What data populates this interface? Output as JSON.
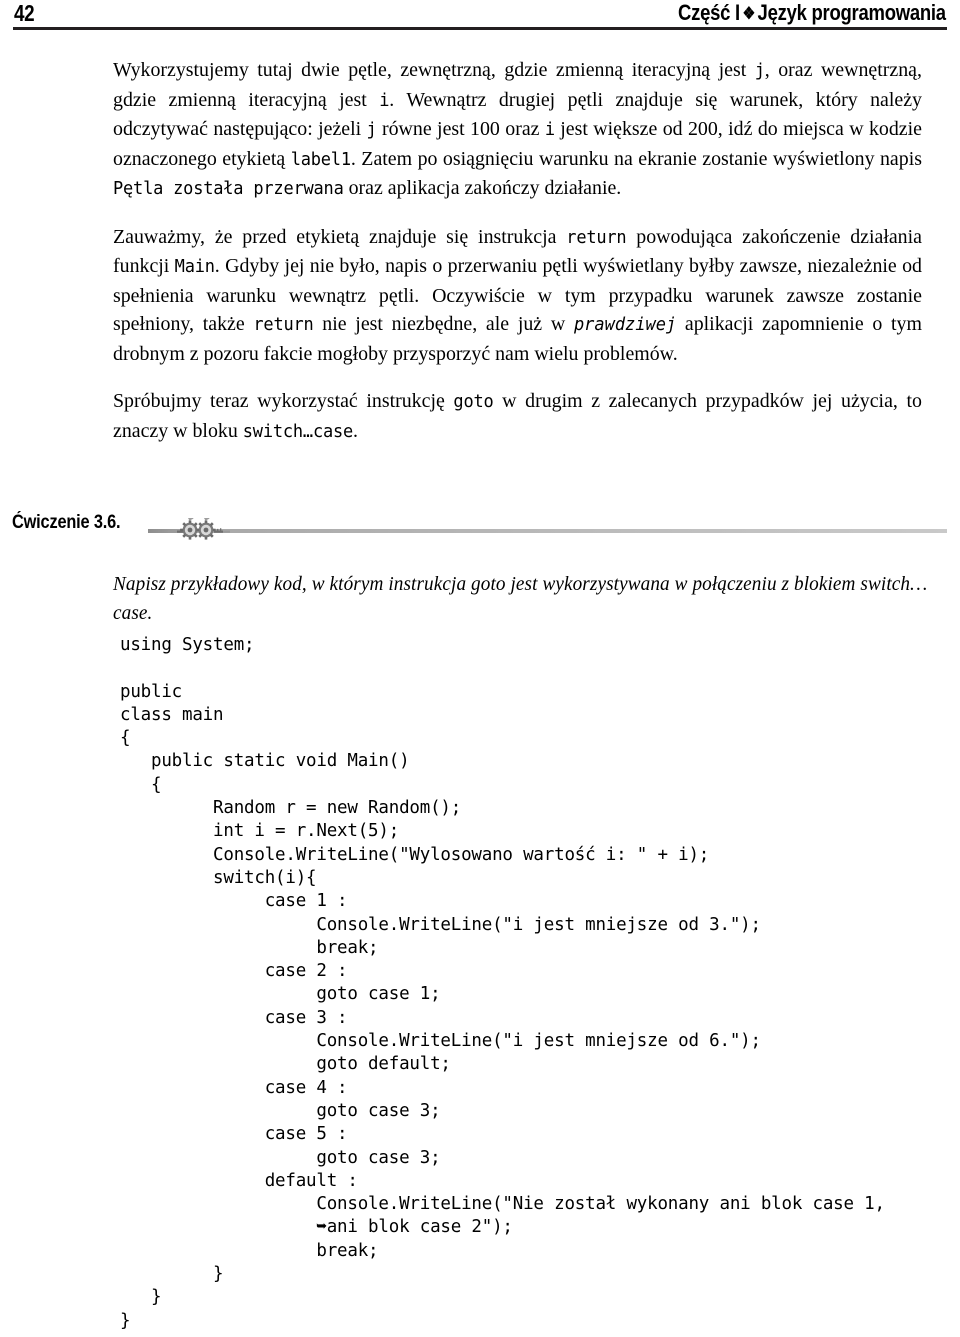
{
  "header": {
    "page_number": "42",
    "title_prefix": "Część I",
    "fleuron": "❖",
    "title_suffix": "Język programowania"
  },
  "paragraphs": [
    {
      "id": "p1",
      "runs": [
        {
          "t": "Wykorzystujemy tutaj dwie pętle, zewnętrzną, gdzie zmienną iteracyjną jest ",
          "s": "text"
        },
        {
          "t": "j",
          "s": "code"
        },
        {
          "t": ", oraz wewnętrzną, gdzie zmienną iteracyjną jest ",
          "s": "text"
        },
        {
          "t": "i",
          "s": "code"
        },
        {
          "t": ". Wewnątrz drugiej pętli znajduje się warunek, który należy odczytywać następująco: jeżeli ",
          "s": "text"
        },
        {
          "t": "j",
          "s": "code"
        },
        {
          "t": " równe jest 100 oraz ",
          "s": "text"
        },
        {
          "t": "i",
          "s": "code"
        },
        {
          "t": " jest większe od 200, idź do miejsca w kodzie oznaczonego etykietą ",
          "s": "text"
        },
        {
          "t": "label1",
          "s": "code"
        },
        {
          "t": ". Zatem po osiągnięciu warunku na ekranie zostanie wyświetlony napis ",
          "s": "text"
        },
        {
          "t": "Pętla została przerwana",
          "s": "code"
        },
        {
          "t": " oraz aplikacja zakończy działanie.",
          "s": "text"
        }
      ]
    },
    {
      "id": "p2",
      "runs": [
        {
          "t": "Zauważmy, że przed etykietą znajduje się instrukcja ",
          "s": "text"
        },
        {
          "t": "return",
          "s": "code"
        },
        {
          "t": " powodująca zakończenie działania funkcji ",
          "s": "text"
        },
        {
          "t": "Main",
          "s": "code"
        },
        {
          "t": ". Gdyby jej nie było, napis o przerwaniu pętli wyświetlany byłby zawsze, niezależnie od spełnienia warunku wewnątrz pętli. Oczywiście w tym przypadku warunek zawsze zostanie spełniony, także ",
          "s": "text"
        },
        {
          "t": "return",
          "s": "code"
        },
        {
          "t": " nie jest niezbędne, ale już w ",
          "s": "text"
        },
        {
          "t": "prawdziwej",
          "s": "italic-mono"
        },
        {
          "t": " aplikacji zapomnienie o tym drobnym z pozoru fakcie mogłoby przysporzyć nam wielu problemów.",
          "s": "text"
        }
      ]
    },
    {
      "id": "p3",
      "runs": [
        {
          "t": "Spróbujmy teraz wykorzystać instrukcję ",
          "s": "text"
        },
        {
          "t": "goto",
          "s": "code"
        },
        {
          "t": " w drugim z zalecanych przypadków jej użycia, to znaczy w bloku ",
          "s": "text"
        },
        {
          "t": "switch…case",
          "s": "code"
        },
        {
          "t": ".",
          "s": "text"
        }
      ]
    }
  ],
  "exercise": {
    "label": "Ćwiczenie 3.6.",
    "ornament_icon": "gears-ornament-icon",
    "description": "Napisz przykładowy kod, w którym instrukcja goto jest wykorzystywana w połączeniu z blokiem switch… case.",
    "code": "using System;\n\npublic\nclass main\n{\n   public static void Main()\n   {\n         Random r = new Random();\n         int i = r.Next(5);\n         Console.WriteLine(\"Wylosowano wartość i: \" + i);\n         switch(i){\n              case 1 :\n                   Console.WriteLine(\"i jest mniejsze od 3.\");\n                   break;\n              case 2 :\n                   goto case 1;\n              case 3 :\n                   Console.WriteLine(\"i jest mniejsze od 6.\");\n                   goto default;\n              case 4 :\n                   goto case 3;\n              case 5 :\n                   goto case 3;\n              default :\n                   Console.WriteLine(\"Nie został wykonany ani blok case 1,\n                   ➥ani blok case 2\");\n                   break;\n         }\n   }\n}"
  },
  "colors": {
    "text": "#000000",
    "header_rule": "#231f20",
    "exercise_rule": "#b0b0b0"
  }
}
